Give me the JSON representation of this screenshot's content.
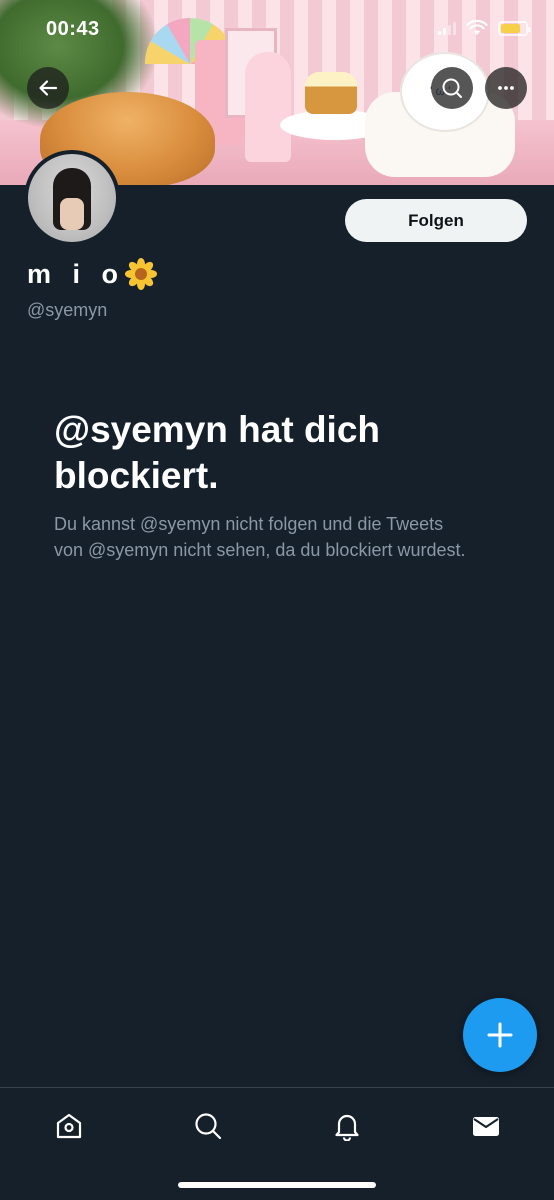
{
  "status_bar": {
    "time": "00:43",
    "battery_level": 0.8,
    "battery_color": "#f6d049"
  },
  "header": {
    "back_icon": "arrow-left-icon",
    "search_icon": "search-icon",
    "more_icon": "more-horizontal-icon"
  },
  "profile": {
    "display_name": "m i o",
    "name_emoji": "sunflower-icon",
    "handle": "@syemyn",
    "follow_label": "Folgen"
  },
  "blocked": {
    "title": "@syemyn hat dich blockiert.",
    "description": "Du kannst @syemyn nicht folgen und die Tweets von @syemyn nicht sehen, da du blockiert wurdest."
  },
  "fab": {
    "icon": "plus-icon"
  },
  "bottom_nav": {
    "items": [
      {
        "icon": "home-icon"
      },
      {
        "icon": "search-icon"
      },
      {
        "icon": "bell-icon"
      },
      {
        "icon": "mail-icon"
      }
    ]
  },
  "colors": {
    "background": "#15202b",
    "accent": "#1d9bf0",
    "secondary_text": "#8b98a5"
  }
}
